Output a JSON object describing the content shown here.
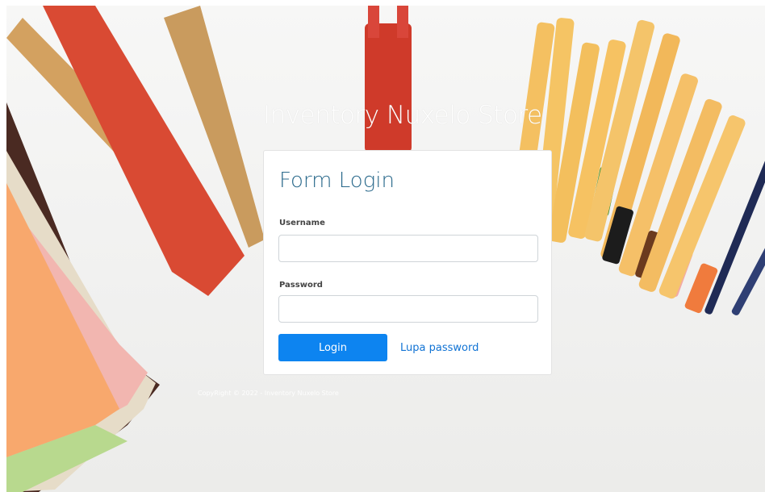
{
  "site": {
    "title": "Inventory Nuxelo Store",
    "copyright": "CopyRight © 2022 - Inventory Nuxelo Store"
  },
  "login_form": {
    "title": "Form Login",
    "username_label": "Username",
    "username_value": "",
    "password_label": "Password",
    "password_value": "",
    "login_button": "Login",
    "forgot_link": "Lupa password"
  },
  "colors": {
    "primary_button": "#0d84f0",
    "link": "#1173d4",
    "card_title": "#2b6a8c"
  }
}
